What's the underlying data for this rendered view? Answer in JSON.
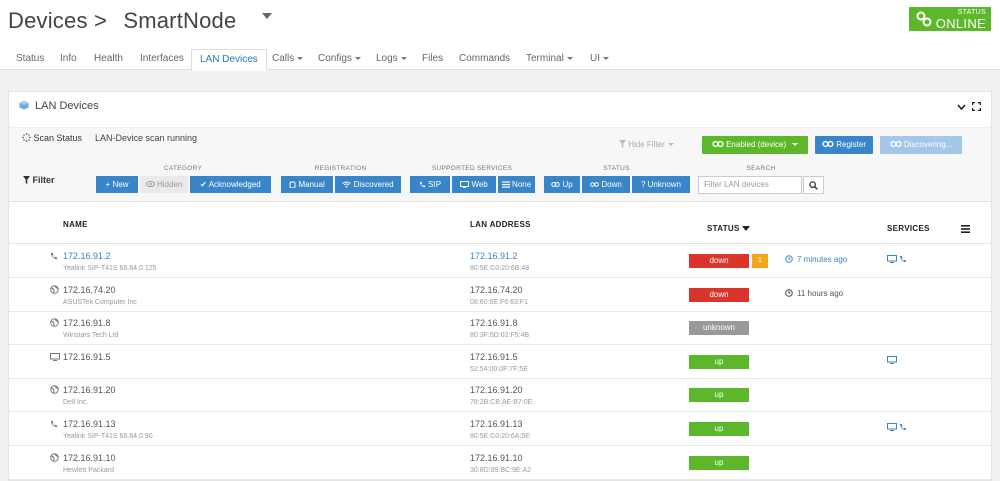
{
  "header": {
    "section": "Devices",
    "separator": ">",
    "device_name": "SmartNode",
    "status_small": "STATUS",
    "status_big": "ONLINE"
  },
  "tabs": [
    {
      "label": "Status",
      "dropdown": false
    },
    {
      "label": "Info",
      "dropdown": false
    },
    {
      "label": "Health",
      "dropdown": false
    },
    {
      "label": "Interfaces",
      "dropdown": false
    },
    {
      "label": "LAN Devices",
      "dropdown": false,
      "active": true
    },
    {
      "label": "Calls",
      "dropdown": true
    },
    {
      "label": "Configs",
      "dropdown": true
    },
    {
      "label": "Logs",
      "dropdown": true
    },
    {
      "label": "Files",
      "dropdown": false
    },
    {
      "label": "Commands",
      "dropdown": false
    },
    {
      "label": "Terminal",
      "dropdown": true
    },
    {
      "label": "UI",
      "dropdown": true
    }
  ],
  "panel": {
    "title": "LAN Devices",
    "scan_label": "Scan Status",
    "scan_text": "LAN-Device scan running",
    "hide_filter": "Hide Filter",
    "enabled_button": "Enabled (device)",
    "register_button": "Register",
    "discovering_button": "Discovering..."
  },
  "filters": {
    "label": "Filter",
    "category": {
      "heading": "CATEGORY",
      "new": "New",
      "hidden": "Hidden",
      "acknowledged": "Acknowledged"
    },
    "registration": {
      "heading": "REGISTRATION",
      "manual": "Manual",
      "discovered": "Discovered"
    },
    "services": {
      "heading": "SUPPORTED SERVICES",
      "sip": "SIP",
      "web": "Web",
      "none": "None"
    },
    "status": {
      "heading": "STATUS",
      "up": "Up",
      "down": "Down",
      "unknown": "Unknown"
    },
    "search": {
      "heading": "SEARCH",
      "placeholder": "Filter LAN devices"
    }
  },
  "table": {
    "headers": {
      "name": "NAME",
      "lan": "LAN ADDRESS",
      "status": "STATUS",
      "services": "SERVICES"
    },
    "rows": [
      {
        "icon": "phone-icon",
        "ip": "172.16.91.2",
        "ip_link": true,
        "desc": "Yealink SIP-T41S 66.84.0.125",
        "lan": "172.16.91.2",
        "lan_link": true,
        "mac": "80:5E:C0:20:6B:48",
        "status": "down",
        "count": "1",
        "time": "7 minutes ago",
        "time_link": true,
        "services": [
          "monitor-icon",
          "phone-icon"
        ]
      },
      {
        "icon": "globe-icon",
        "ip": "172.16.74.20",
        "ip_link": false,
        "desc": "ASUSTek Computer Inc",
        "lan": "172.16.74.20",
        "lan_link": false,
        "mac": "08:60:6E:F6:63:F1",
        "status": "down",
        "count": "",
        "time": "11 hours ago",
        "time_link": false,
        "services": []
      },
      {
        "icon": "globe-icon",
        "ip": "172.16.91.8",
        "ip_link": false,
        "desc": "Winstars Tech Ltd",
        "lan": "172.16.91.8",
        "lan_link": false,
        "mac": "80:3F:5D:02:F5:4B",
        "status": "unknown",
        "count": "",
        "time": "",
        "time_link": false,
        "services": []
      },
      {
        "icon": "monitor-icon",
        "ip": "172.16.91.5",
        "ip_link": false,
        "desc": "",
        "lan": "172.16.91.5",
        "lan_link": false,
        "mac": "52:54:00:0F:7F:5E",
        "status": "up",
        "count": "",
        "time": "",
        "time_link": false,
        "services": [
          "monitor-icon"
        ]
      },
      {
        "icon": "globe-icon",
        "ip": "172.16.91.20",
        "ip_link": false,
        "desc": "Dell Inc.",
        "lan": "172.16.91.20",
        "lan_link": false,
        "mac": "78:2B:CB:AE:B7:0E",
        "status": "up",
        "count": "",
        "time": "",
        "time_link": false,
        "services": []
      },
      {
        "icon": "phone-icon",
        "ip": "172.16.91.13",
        "ip_link": false,
        "desc": "Yealink SIP-T41S 66.84.0.90",
        "lan": "172.16.91.13",
        "lan_link": false,
        "mac": "80:5E:C0:20:6A:5E",
        "status": "up",
        "count": "",
        "time": "",
        "time_link": false,
        "services": [
          "monitor-icon",
          "phone-icon"
        ]
      },
      {
        "icon": "globe-icon",
        "ip": "172.16.91.10",
        "ip_link": false,
        "desc": "Hewlett Packard",
        "lan": "172.16.91.10",
        "lan_link": false,
        "mac": "30:8D:99:BC:9E:A2",
        "status": "up",
        "count": "",
        "time": "",
        "time_link": false,
        "services": []
      }
    ]
  },
  "colors": {
    "green": "#5cb82a",
    "blue": "#3886c9",
    "red": "#d9352a",
    "grey": "#999999",
    "orange": "#f0a818"
  }
}
